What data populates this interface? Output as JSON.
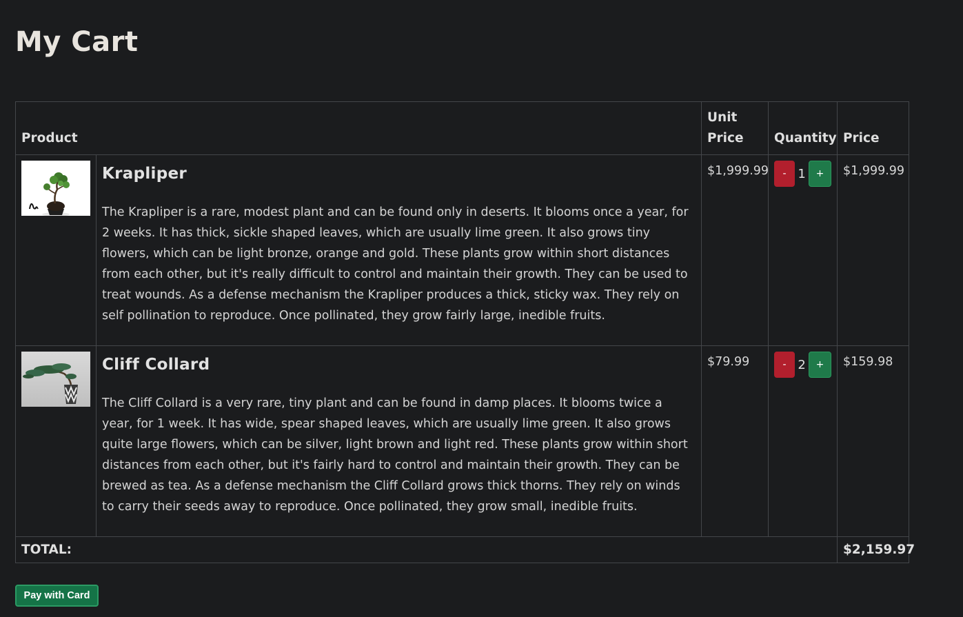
{
  "page": {
    "title": "My Cart"
  },
  "table": {
    "headers": {
      "product": "Product",
      "unit_price_line1": "Unit",
      "unit_price_line2": "Price",
      "quantity": "Quantity",
      "price": "Price"
    },
    "items": [
      {
        "name": "Krapliper",
        "description": "The Krapliper is a rare, modest plant and can be found only in deserts. It blooms once a year, for 2 weeks. It has thick, sickle shaped leaves, which are usually lime green. It also grows tiny flowers, which can be light bronze, orange and gold. These plants grow within short distances from each other, but it's really difficult to control and maintain their growth. They can be used to treat wounds. As a defense mechanism the Krapliper produces a thick, sticky wax. They rely on self pollination to reproduce. Once pollinated, they grow fairly large, inedible fruits.",
        "unit_price": "$1,999.99",
        "quantity": "1",
        "price": "$1,999.99",
        "minus_label": "-",
        "plus_label": "+"
      },
      {
        "name": "Cliff Collard",
        "description": "The Cliff Collard is a very rare, tiny plant and can be found in damp places. It blooms twice a year, for 1 week. It has wide, spear shaped leaves, which are usually lime green. It also grows quite large flowers, which can be silver, light brown and light red. These plants grow within short distances from each other, but it's fairly hard to control and maintain their growth. They can be brewed as tea. As a defense mechanism the Cliff Collard grows thick thorns. They rely on winds to carry their seeds away to reproduce. Once pollinated, they grow small, inedible fruits.",
        "unit_price": "$79.99",
        "quantity": "2",
        "price": "$159.98",
        "minus_label": "-",
        "plus_label": "+"
      }
    ],
    "total_label": "TOTAL:",
    "total_value": "$2,159.97"
  },
  "actions": {
    "pay_label": "Pay with Card"
  },
  "colors": {
    "background": "#1b1c1e",
    "minus_button": "#b21f2d",
    "plus_button": "#1f7a4a",
    "pay_button": "#157347"
  }
}
